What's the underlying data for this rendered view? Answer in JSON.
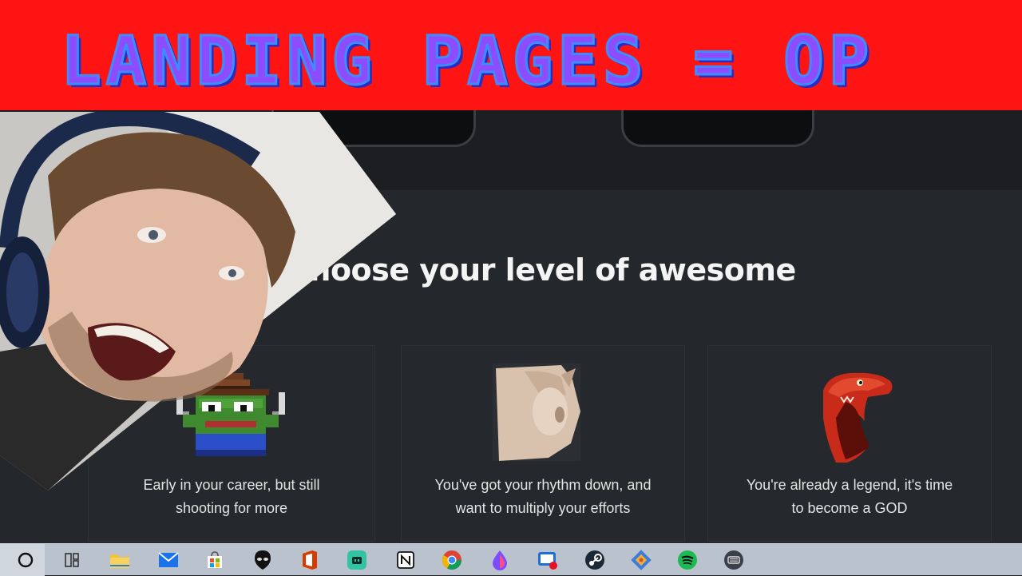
{
  "banner": {
    "title": "LANDING PAGES = OP"
  },
  "page": {
    "section_title": "Choose your level of awesome",
    "tiers": [
      {
        "line1": "Early in your career, but still",
        "line2": "shooting for more",
        "image": "pixel-frog-cowboy"
      },
      {
        "line1": "You've got your rhythm down, and",
        "line2": "want to multiply your efforts",
        "image": "cat-face"
      },
      {
        "line1": "You're already a legend, it's time",
        "line2": "to become a GOD",
        "image": "screaming-raptor"
      }
    ]
  },
  "webcam": {
    "content": "streamer-face-overlay"
  },
  "taskbar": {
    "icons": [
      "search-circle-icon",
      "task-view-icon",
      "file-explorer-icon",
      "mail-icon",
      "store-icon",
      "alienware-icon",
      "office-icon",
      "streamlabs-icon",
      "notion-icon",
      "chrome-icon",
      "droplet-app-icon",
      "photos-app-icon",
      "steam-icon",
      "git-app-icon",
      "spotify-icon",
      "keyboard-icon"
    ]
  },
  "colors": {
    "banner_bg": "#ff1414",
    "banner_text": "#8e4cff",
    "page_bg": "#24272b",
    "taskbar_bg": "#b9c2cd"
  }
}
